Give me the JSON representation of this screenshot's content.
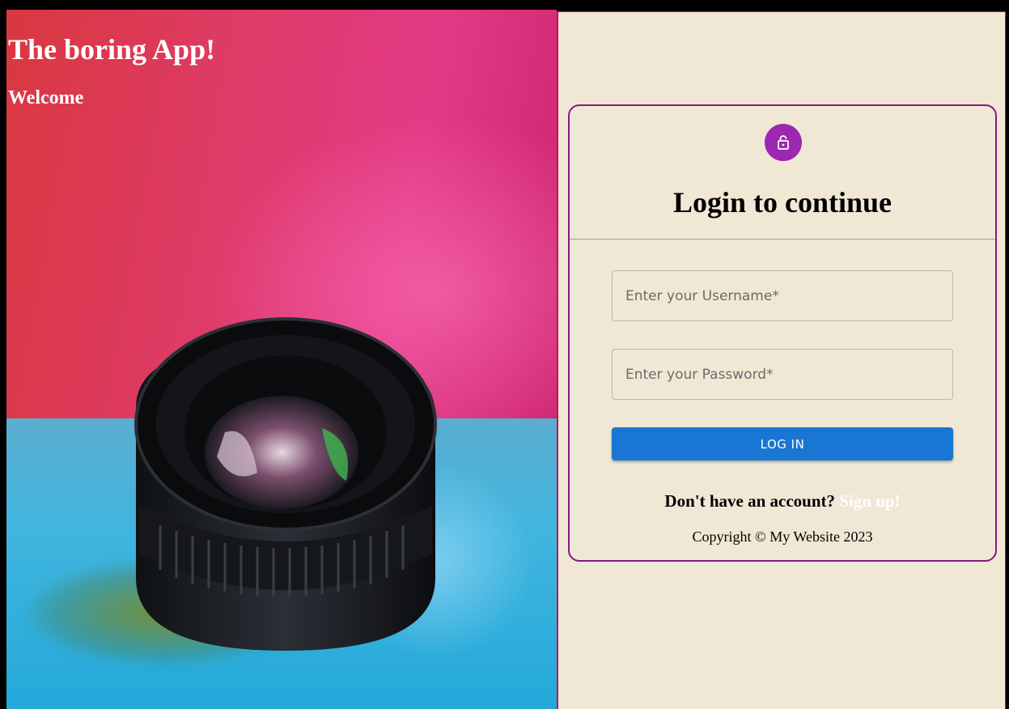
{
  "hero": {
    "title": "The boring App!",
    "subtitle": "Welcome",
    "image_description_icon": "camera-lens-photo"
  },
  "login_card": {
    "icon": "lock-open-icon",
    "heading": "Login to continue",
    "username_placeholder": "Enter your Username*",
    "password_placeholder": "Enter your Password*",
    "login_button": "LOG IN",
    "signup_prompt": "Don't have an account?",
    "signup_link": "Sign up!",
    "copyright": "Copyright © My Website 2023"
  },
  "colors": {
    "panel_bg": "#f0e8d5",
    "card_border": "#86197f",
    "lock_circle": "#9c27b0",
    "login_button": "#1976d2"
  }
}
